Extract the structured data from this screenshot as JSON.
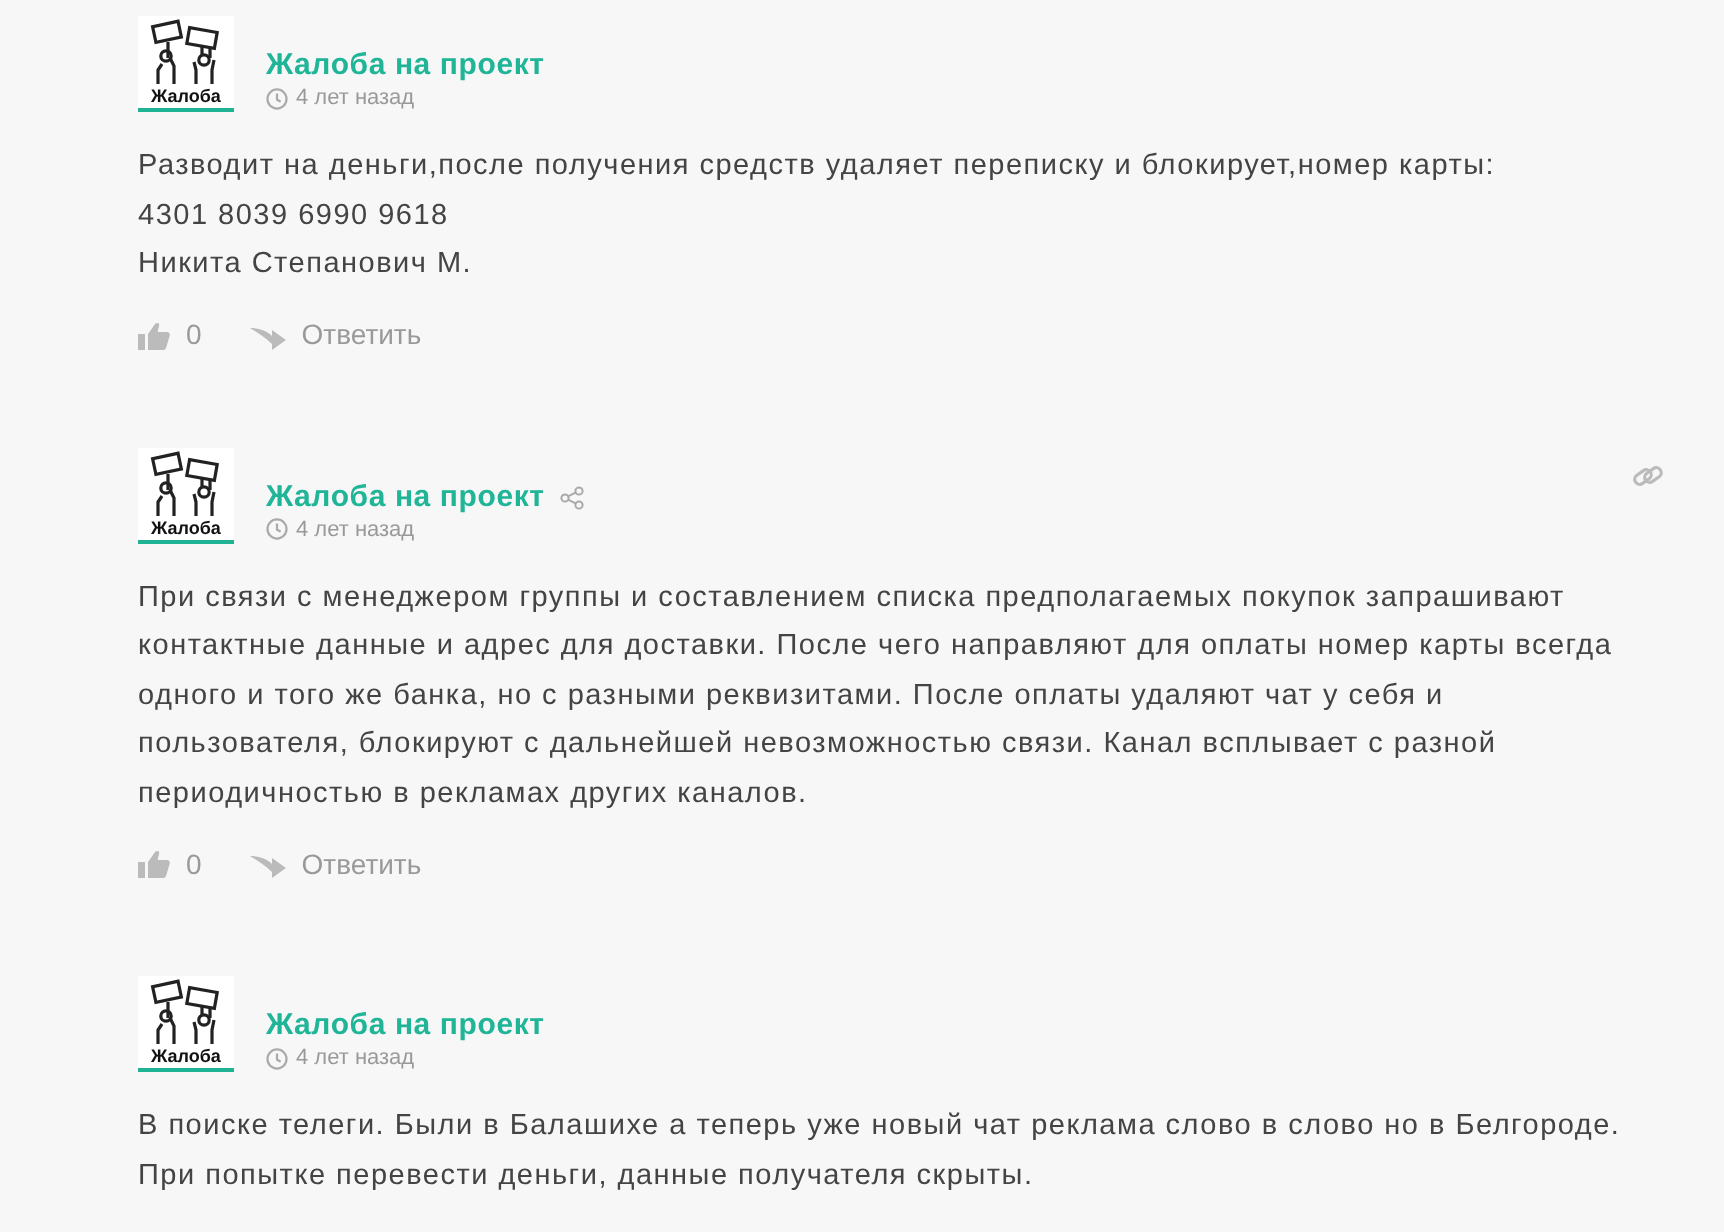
{
  "comments": [
    {
      "avatar_label": "Жалоба",
      "author": "Жалоба на проект",
      "time": "4 лет назад",
      "hovered": false,
      "lines": [
        "Разводит на деньги,после получения средств удаляет переписку и блокирует,номер карты:",
        "4301 8039 6990 9618",
        "Никита Степанович М."
      ],
      "likes": "0",
      "reply": "Ответить"
    },
    {
      "avatar_label": "Жалоба",
      "author": "Жалоба на проект",
      "time": "4 лет назад",
      "hovered": true,
      "lines": [
        "При связи с менеджером группы и составлением списка предполагаемых покупок запрашивают контактные данные и адрес для доставки. После чего направляют для оплаты номер карты всегда одного и того же банка, но с разными реквизитами. После оплаты удаляют чат у себя и пользователя, блокируют с дальнейшей невозможностью связи. Канал всплывает с разной периодичностью в рекламах других каналов."
      ],
      "likes": "0",
      "reply": "Ответить"
    },
    {
      "avatar_label": "Жалоба",
      "author": "Жалоба на проект",
      "time": "4 лет назад",
      "hovered": false,
      "lines": [
        "В поиске телеги. Были в Балашихе а теперь уже новый чат реклама слово в слово но в Белгороде. При попытке перевести деньги, данные получателя скрыты."
      ]
    }
  ]
}
